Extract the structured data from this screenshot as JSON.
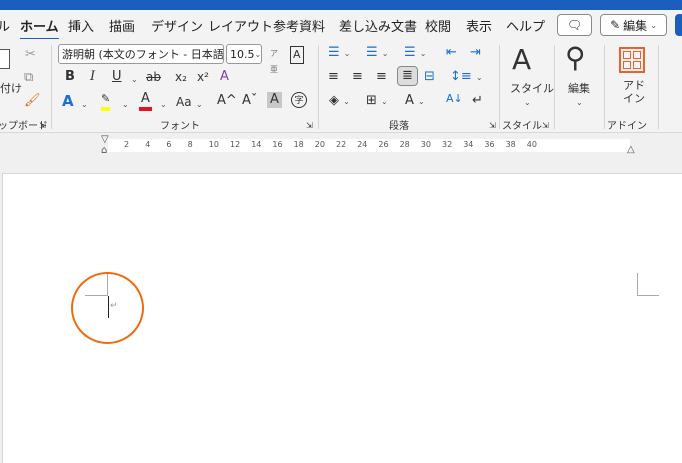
{
  "tabs": [
    "ル",
    "ホーム",
    "挿入",
    "描画",
    "デザイン",
    "レイアウト",
    "参考資料",
    "差し込み文書",
    "校閲",
    "表示",
    "ヘルプ"
  ],
  "active_tab": "ホーム",
  "edit_mode_label": "編集",
  "clipboard": {
    "paste_label": "付け",
    "group_label": "ップボード"
  },
  "font": {
    "name": "游明朝 (本文のフォント - 日本語",
    "size": "10.5",
    "group_label": "フォント",
    "buttons": {
      "bold": "B",
      "italic": "I",
      "underline": "U",
      "strike": "ab",
      "sub": "x₂",
      "sup": "x²",
      "case": "Aa",
      "grow": "A^",
      "shrink": "Aˇ",
      "shade": "A",
      "enclose": "字",
      "effects": "A",
      "highlight": "ab",
      "color": "A"
    },
    "highlight_color": "#ffff00",
    "font_color": "#e81123"
  },
  "paragraph": {
    "group_label": "段落"
  },
  "styles": {
    "button_label": "スタイル",
    "group_label": "スタイル"
  },
  "editing": {
    "button_label": "編集"
  },
  "addins": {
    "button_label": "アド\nイン",
    "group_label": "アドイン"
  },
  "ruler": {
    "ticks": [
      "2",
      "4",
      "6",
      "8",
      "10",
      "12",
      "14",
      "16",
      "18",
      "20",
      "22",
      "24",
      "26",
      "28",
      "30",
      "32",
      "34",
      "36",
      "38",
      "40"
    ]
  },
  "annotation_color": "#f06a10",
  "accent": "#1b5ebe"
}
